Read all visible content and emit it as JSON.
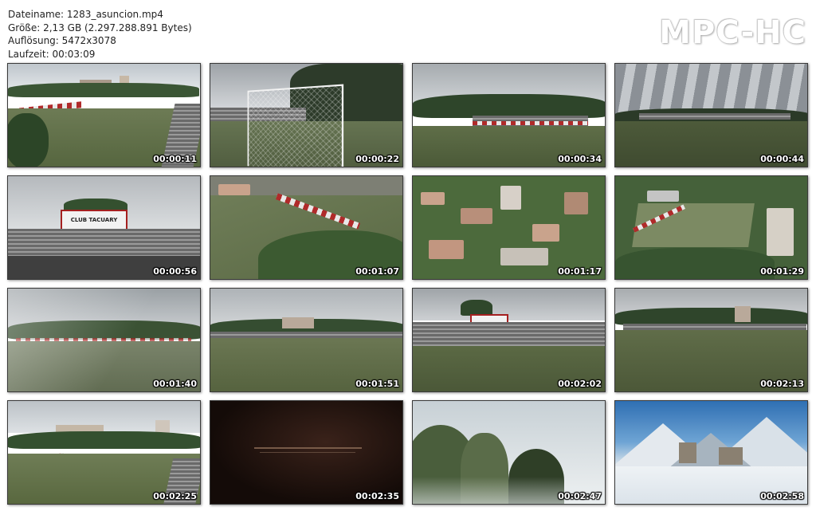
{
  "info": {
    "filename": "Dateiname: 1283_asuncion.mp4",
    "size": "Größe: 2,13 GB (2.297.288.891 Bytes)",
    "resolution": "Auflösung: 5472x3078",
    "duration": "Laufzeit: 00:03:09"
  },
  "logo": "MPC-HC",
  "thumbnails": [
    {
      "timestamp": "00:00:11",
      "scene": "stadium-aerial-wide"
    },
    {
      "timestamp": "00:00:22",
      "scene": "goal-net"
    },
    {
      "timestamp": "00:00:34",
      "scene": "pitch-far-stand"
    },
    {
      "timestamp": "00:00:44",
      "scene": "pitch-cloudy-sky"
    },
    {
      "timestamp": "00:00:56",
      "scene": "grandstand-sign"
    },
    {
      "timestamp": "00:01:07",
      "scene": "aerial-pitch-angle"
    },
    {
      "timestamp": "00:01:17",
      "scene": "aerial-city"
    },
    {
      "timestamp": "00:01:29",
      "scene": "aerial-stadium-city"
    },
    {
      "timestamp": "00:01:40",
      "scene": "pitch-crossfade"
    },
    {
      "timestamp": "00:01:51",
      "scene": "pitch-low"
    },
    {
      "timestamp": "00:02:02",
      "scene": "grandstand-pitch"
    },
    {
      "timestamp": "00:02:13",
      "scene": "pitch-evening"
    },
    {
      "timestamp": "00:02:25",
      "scene": "stadium-aerial-2"
    },
    {
      "timestamp": "00:02:35",
      "scene": "title-card"
    },
    {
      "timestamp": "00:02:47",
      "scene": "karst-mountains"
    },
    {
      "timestamp": "00:02:58",
      "scene": "snow-mountains-church"
    }
  ],
  "overlays": {
    "sign_text": "CLUB TACUARY"
  },
  "colors": {
    "grass": "#5f6e48",
    "sky": "#c9ccd0",
    "accent_red": "#b02a2a"
  }
}
